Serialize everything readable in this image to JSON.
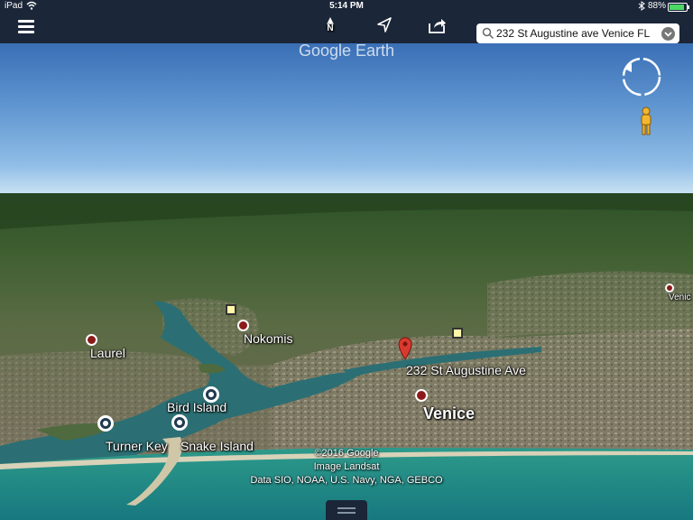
{
  "status_bar": {
    "device": "iPad",
    "time": "5:14 PM",
    "battery_percent": "88%",
    "battery_level": 0.88,
    "icons": [
      "wifi-icon",
      "bluetooth-icon",
      "battery-icon"
    ]
  },
  "toolbar": {
    "north_label": "N",
    "icons": [
      "menu-icon",
      "north-arrow-icon",
      "location-arrow-icon",
      "share-icon",
      "search-icon",
      "chevron-down-icon"
    ],
    "search_query": "232 St Augustine ave Venice FL"
  },
  "map": {
    "watermark": "Google Earth",
    "places": {
      "laurel": "Laurel",
      "nokomis": "Nokomis",
      "bird_island": "Bird Island",
      "turner_key": "Turner Key",
      "snake_island": "Snake Island",
      "venice": "Venice",
      "venice_edge": "Venic",
      "searched_address": "232 St Augustine Ave"
    },
    "attribution": {
      "copyright": "©2016 Google",
      "image": "Image Landsat",
      "data": "Data SIO, NOAA, U.S. Navy, NGA, GEBCO"
    },
    "colors": {
      "toolbar": "#1b2638",
      "water": "#2f8f7f",
      "land": "#5a6b3e",
      "pin": "#d93a2f",
      "poi": "#8b1a1a"
    }
  }
}
